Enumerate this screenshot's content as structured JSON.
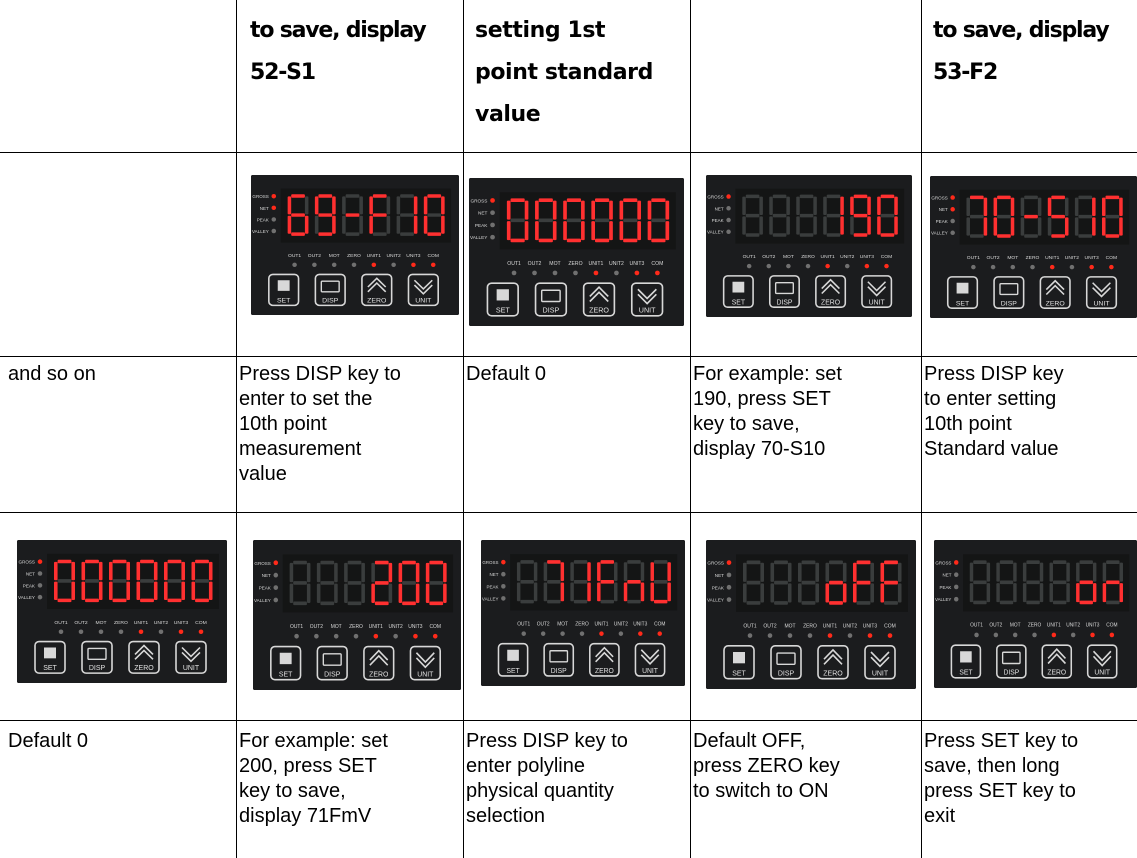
{
  "headers": [
    "",
    "to save, display\n52-S1",
    "setting 1st\npoint standard\nvalue",
    "",
    "to save, display\n53-F2"
  ],
  "row2_text": [
    "and so on",
    "Press DISP key to\nenter to set the\n10th point\nmeasurement\nvalue",
    "Default 0",
    "For example: set\n190, press SET\nkey to save,\ndisplay 70-S10",
    "Press DISP key\nto enter setting\n10th point\nStandard value"
  ],
  "row4_text": [
    "Default 0",
    "For example: set\n200, press SET\nkey to save,\ndisplay 71FmV",
    "Press DISP key to\nenter polyline\nphysical quantity\nselection",
    "Default OFF,\npress ZERO key\nto switch to ON",
    "Press SET key to\nsave, then long\npress SET key to\nexit"
  ],
  "meter": {
    "indicator_labels": [
      "GROSS",
      "NET",
      "PEAK",
      "VALLEY"
    ],
    "status_labels": [
      "OUT1",
      "OUT2",
      "MOT",
      "ZERO",
      "UNIT1",
      "UNIT2",
      "UNIT3",
      "COM"
    ],
    "key_labels": [
      "SET",
      "DISP",
      "ZERO",
      "UNIT"
    ],
    "colors": {
      "segment_on": "#ff3030",
      "segment_off": "#3a3d3d",
      "led_on": "#ff2a1a",
      "led_off": "#707070",
      "panel": "#1b1c1e"
    }
  },
  "displays": [
    {
      "text": "69-F10",
      "indicators": [
        1,
        1,
        0,
        0
      ],
      "status": [
        0,
        0,
        0,
        0,
        1,
        0,
        1,
        1
      ]
    },
    {
      "text": "000000",
      "indicators": [
        1,
        0,
        0,
        0
      ],
      "status": [
        0,
        0,
        0,
        0,
        1,
        0,
        1,
        1
      ]
    },
    {
      "text": "190",
      "indicators": [
        1,
        0,
        0,
        0
      ],
      "status": [
        0,
        0,
        0,
        0,
        1,
        0,
        1,
        1
      ]
    },
    {
      "text": "70-S10",
      "indicators": [
        1,
        1,
        0,
        0
      ],
      "status": [
        0,
        0,
        0,
        0,
        1,
        0,
        1,
        1
      ]
    },
    {
      "text": "000000",
      "indicators": [
        1,
        0,
        0,
        0
      ],
      "status": [
        0,
        0,
        0,
        0,
        1,
        0,
        1,
        1
      ]
    },
    {
      "text": "200",
      "indicators": [
        1,
        0,
        0,
        0
      ],
      "status": [
        0,
        0,
        0,
        0,
        1,
        0,
        1,
        1
      ]
    },
    {
      "text": "71FmV",
      "indicators": [
        1,
        0,
        0,
        0
      ],
      "status": [
        0,
        0,
        0,
        0,
        1,
        0,
        1,
        1
      ]
    },
    {
      "text": "oFF",
      "indicators": [
        1,
        0,
        0,
        0
      ],
      "status": [
        0,
        0,
        0,
        0,
        1,
        0,
        1,
        1
      ]
    },
    {
      "text": "on",
      "indicators": [
        1,
        0,
        0,
        0
      ],
      "status": [
        0,
        0,
        0,
        0,
        1,
        0,
        1,
        1
      ]
    }
  ]
}
